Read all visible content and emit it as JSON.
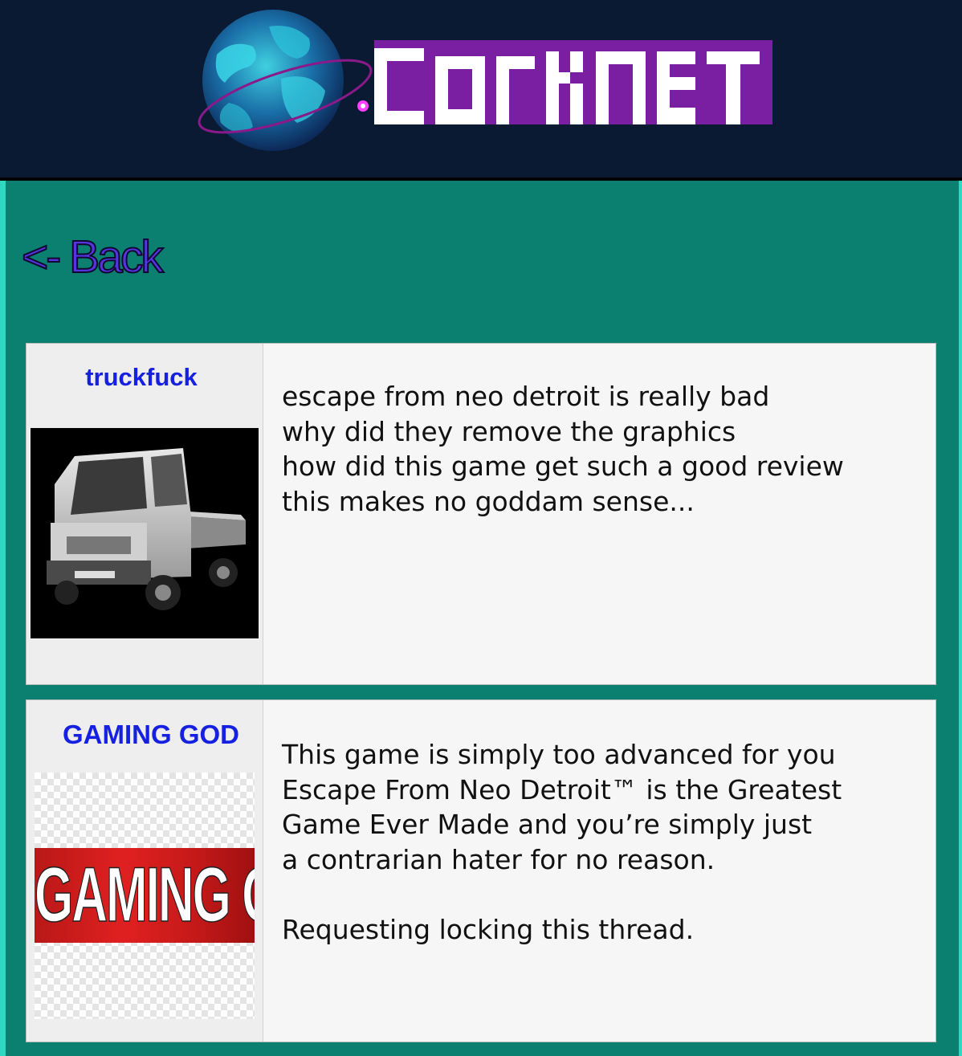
{
  "site": {
    "logo_text": "CORKNET"
  },
  "nav": {
    "back_label": "<- Back"
  },
  "posts": [
    {
      "username": "truckfuck",
      "lines": [
        "escape from neo detroit is really bad",
        "why did they remove the graphics",
        "how did this game get such a good review",
        "this makes no goddam sense..."
      ]
    },
    {
      "username": "GAMING GOD",
      "avatar_text": "GAMING GOD",
      "lines": [
        "This game is simply too advanced for you",
        "Escape From Neo Detroit™ is the Greatest",
        "Game Ever Made and you’re simply just",
        "a contrarian hater for no reason."
      ],
      "closing": "Requesting locking this thread."
    }
  ],
  "colors": {
    "header_bg": "#0a1a33",
    "page_bg": "#0b8070",
    "accent_purple": "#7b1fa2",
    "username_blue": "#1520e0",
    "back_link": "#5535e0"
  }
}
